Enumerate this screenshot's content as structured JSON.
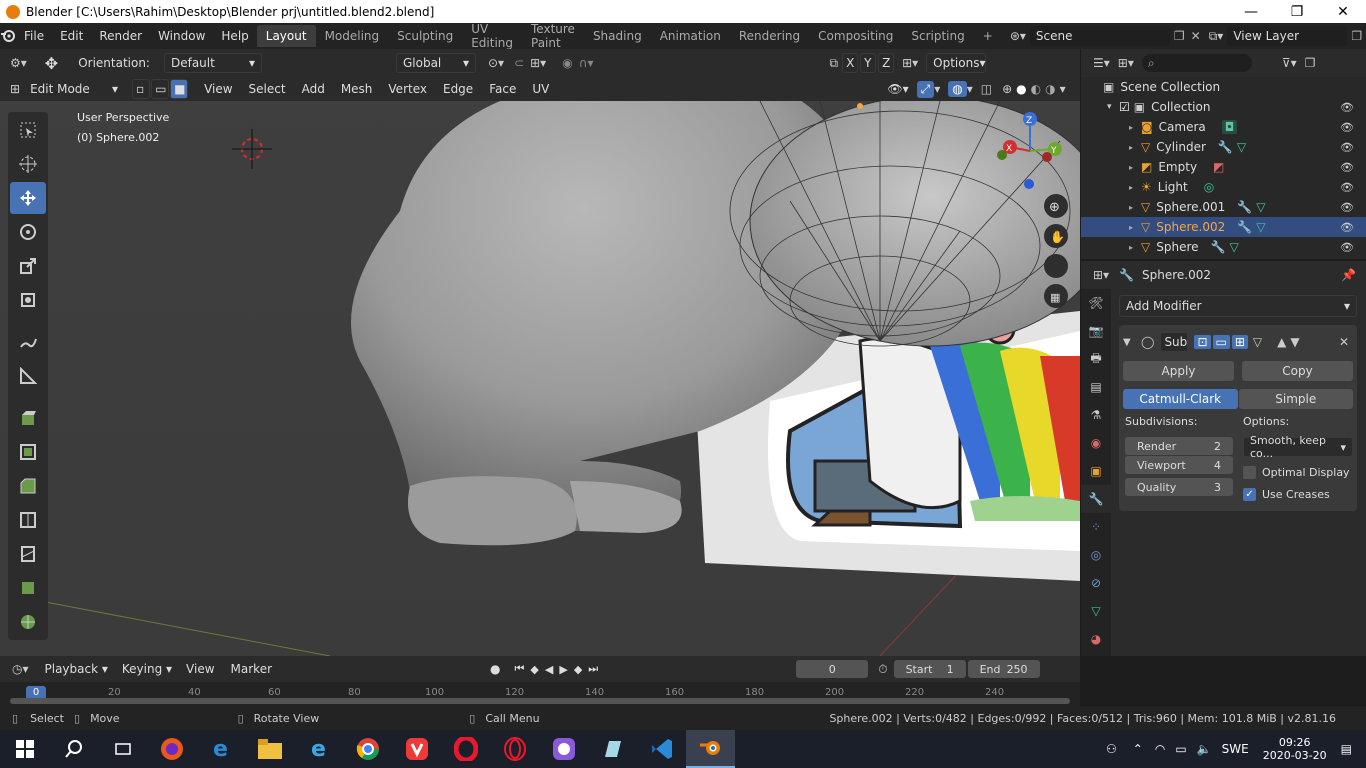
{
  "window": {
    "title": "Blender [C:\\Users\\Rahim\\Desktop\\Blender prj\\untitled.blend2.blend]",
    "minimize": "—",
    "maximize": "❐",
    "close": "✕"
  },
  "menus": [
    "File",
    "Edit",
    "Render",
    "Window",
    "Help"
  ],
  "workspaces": [
    "Layout",
    "Modeling",
    "Sculpting",
    "UV Editing",
    "Texture Paint",
    "Shading",
    "Animation",
    "Rendering",
    "Compositing",
    "Scripting"
  ],
  "active_workspace": "Layout",
  "scene": {
    "name": "Scene",
    "view_layer": "View Layer"
  },
  "tool_header": {
    "orientation_label": "Orientation:",
    "orientation": "Default",
    "transform": "Global",
    "options": "Options",
    "axes": [
      "X",
      "Y",
      "Z"
    ]
  },
  "mode_header": {
    "mode": "Edit Mode",
    "items": [
      "View",
      "Select",
      "Add",
      "Mesh",
      "Vertex",
      "Edge",
      "Face",
      "UV"
    ]
  },
  "viewport": {
    "perspective": "User Perspective",
    "object": "(0) Sphere.002"
  },
  "outliner": {
    "search_placeholder": "",
    "root": "Scene Collection",
    "collection": "Collection",
    "items": [
      "Camera",
      "Cylinder",
      "Empty",
      "Light",
      "Sphere.001",
      "Sphere.002",
      "Sphere"
    ],
    "selected": "Sphere.002"
  },
  "properties": {
    "object": "Sphere.002",
    "add_modifier": "Add Modifier",
    "modifier_name": "Sub",
    "apply": "Apply",
    "copy": "Copy",
    "catmull": "Catmull-Clark",
    "simple": "Simple",
    "subdivisions_label": "Subdivisions:",
    "options_label": "Options:",
    "render_label": "Render",
    "render_val": "2",
    "viewport_label": "Viewport",
    "viewport_val": "4",
    "quality_label": "Quality",
    "quality_val": "3",
    "uv_smooth": "Smooth, keep co...",
    "optimal_display": "Optimal Display",
    "use_creases": "Use Creases",
    "optimal_checked": false,
    "creases_checked": true
  },
  "timeline": {
    "playback": "Playback",
    "keying": "Keying",
    "view": "View",
    "marker": "Marker",
    "current": "0",
    "start_label": "Start",
    "start": "1",
    "end_label": "End",
    "end": "250",
    "ticks": [
      "0",
      "20",
      "40",
      "60",
      "80",
      "100",
      "120",
      "140",
      "160",
      "180",
      "200",
      "220",
      "240"
    ]
  },
  "statusbar": {
    "select": "Select",
    "move": "Move",
    "rotate": "Rotate View",
    "call_menu": "Call Menu",
    "stats": "Sphere.002 | Verts:0/482 | Edges:0/992 | Faces:0/512 | Tris:960 | Mem: 101.8 MiB | v2.81.16"
  },
  "taskbar": {
    "time": "09:26",
    "date": "2020-03-20",
    "lang": "SWE"
  },
  "colors": {
    "accent": "#4772b3",
    "selected_text": "#f5a742",
    "orange": "#e87d0d"
  }
}
